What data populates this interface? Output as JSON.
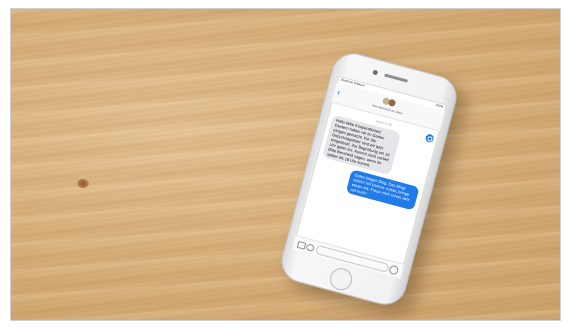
{
  "scene": {
    "description_colors": {
      "wood": "#d8b07a",
      "phone_body": "#f2f2f3",
      "accent_blue": "#1f7aea"
    }
  },
  "phone": {
    "status_left": "Deutsche Telekom",
    "status_right": "100%",
    "group_name": "Ihre Nachricht an Joline",
    "thread_meta": "Heute 10:26",
    "messages": [
      {
        "direction": "incoming",
        "text": "Hallo liebe Kooperationen! Gestern haben wir im Garten einiges gemacht. Für die Geburtstagsfeier sind wir jetzt eingedeckt. Zur Begrüßung um 16 Uhr gehts los. Kommt noch vorbei! Bitte Bescheid sagen, wenn ihr später als 18 Uhr kommt."
      },
      {
        "direction": "outgoing",
        "text": "Gutes langes Ding. Das klingt schön! Ich komme vorbei, bringe etwas mit. Freue mich schon sehr auf euch!"
      }
    ],
    "input_placeholder": ""
  }
}
